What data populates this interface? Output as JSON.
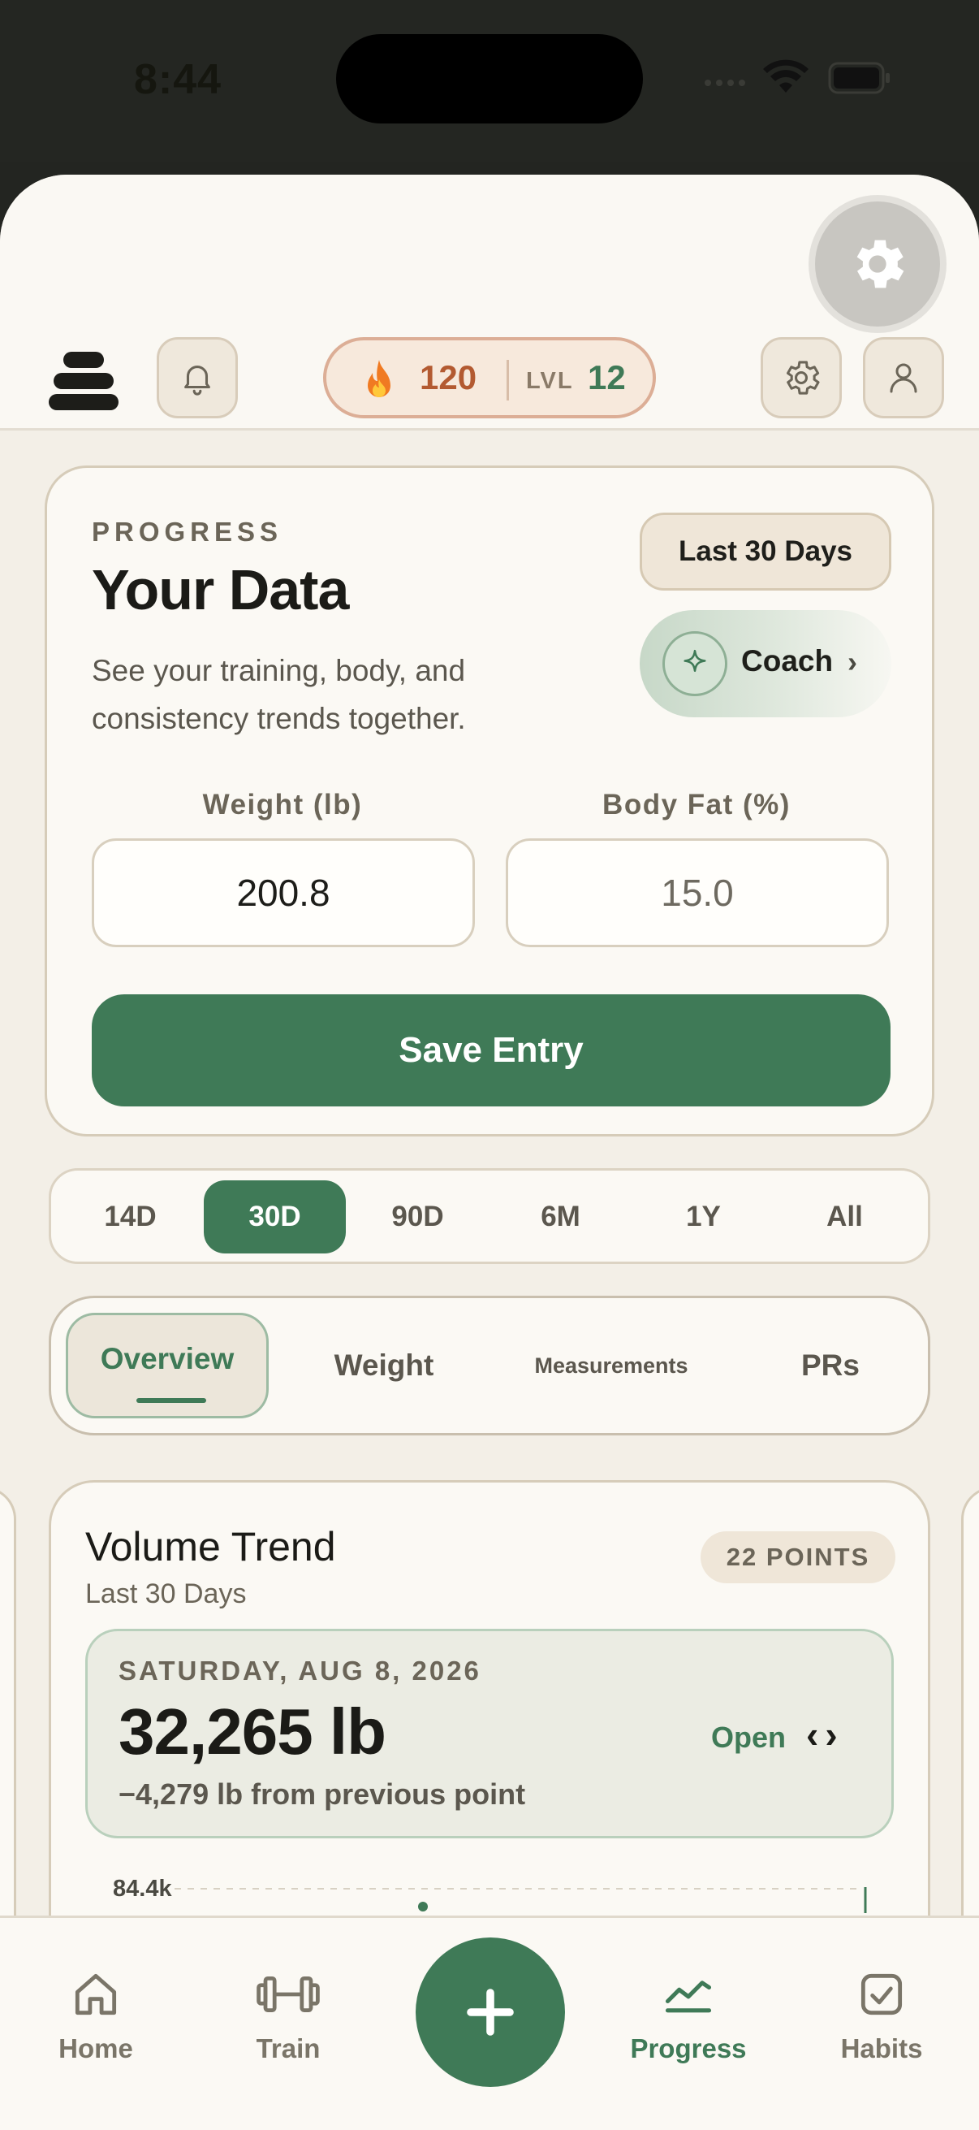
{
  "status_bar": {
    "time": "8:44"
  },
  "header": {
    "streak_count": "120",
    "level_label": "LVL",
    "level_value": "12",
    "icons": [
      "menu-icon",
      "bell-icon",
      "flame-icon",
      "gear-icon",
      "user-icon"
    ]
  },
  "progress_card": {
    "eyebrow": "PROGRESS",
    "title": "Your Data",
    "description": "See your training, body, and consistency trends together.",
    "range_badge": "Last 30 Days",
    "coach_label": "Coach",
    "coach_chevron": "›",
    "weight_label": "Weight (lb)",
    "weight_value": "200.8",
    "bodyfat_label": "Body Fat (%)",
    "bodyfat_value": "15.0",
    "save_label": "Save Entry"
  },
  "range_selector": {
    "options": [
      "14D",
      "30D",
      "90D",
      "6M",
      "1Y",
      "All"
    ],
    "selected": "30D"
  },
  "tabs": {
    "items": [
      "Overview",
      "Weight",
      "Measurements",
      "PRs"
    ],
    "selected": "Overview"
  },
  "volume_card": {
    "title": "Volume Trend",
    "subtitle": "Last 30 Days",
    "points_badge": "22 POINTS",
    "selected_date": "SATURDAY, AUG 8, 2026",
    "selected_value": "32,265 lb",
    "delta_text": "−4,279 lb from previous point",
    "open_label": "Open",
    "prev_arrow": "‹",
    "next_arrow": "›",
    "y_tick_top": "84.4k"
  },
  "bottom_nav": {
    "items": [
      {
        "label": "Home",
        "icon": "home-icon"
      },
      {
        "label": "Train",
        "icon": "dumbbell-icon"
      },
      {
        "label": "Progress",
        "icon": "trend-chart-icon"
      },
      {
        "label": "Habits",
        "icon": "checkbox-icon"
      }
    ],
    "selected": "Progress",
    "fab_symbol": "+"
  },
  "colors": {
    "accent_green": "#3f7a57",
    "streak_orange": "#b35a31",
    "background": "#f3efe7",
    "card": "#fbf9f4"
  }
}
